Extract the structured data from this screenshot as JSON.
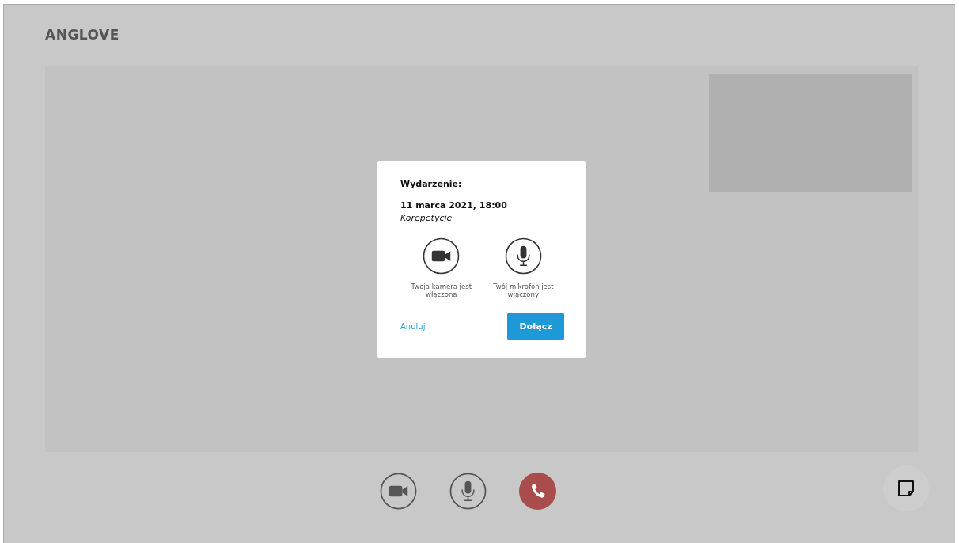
{
  "brand": "ANGLOVE",
  "dialog": {
    "heading": "Wydarzenie:",
    "date": "11 marca 2021, 18:00",
    "event": "Korepetycje",
    "devices": [
      {
        "kind": "camera",
        "on": true,
        "label": "Twoja kamera jest włączona"
      },
      {
        "kind": "mic",
        "on": true,
        "label": "Twój mikrofon jest włączony"
      }
    ],
    "cancel": "Anuluj",
    "join": "Dołącz"
  },
  "controls": [
    {
      "kind": "camera",
      "on": true
    },
    {
      "kind": "mic",
      "on": true
    },
    {
      "kind": "hangup"
    }
  ]
}
